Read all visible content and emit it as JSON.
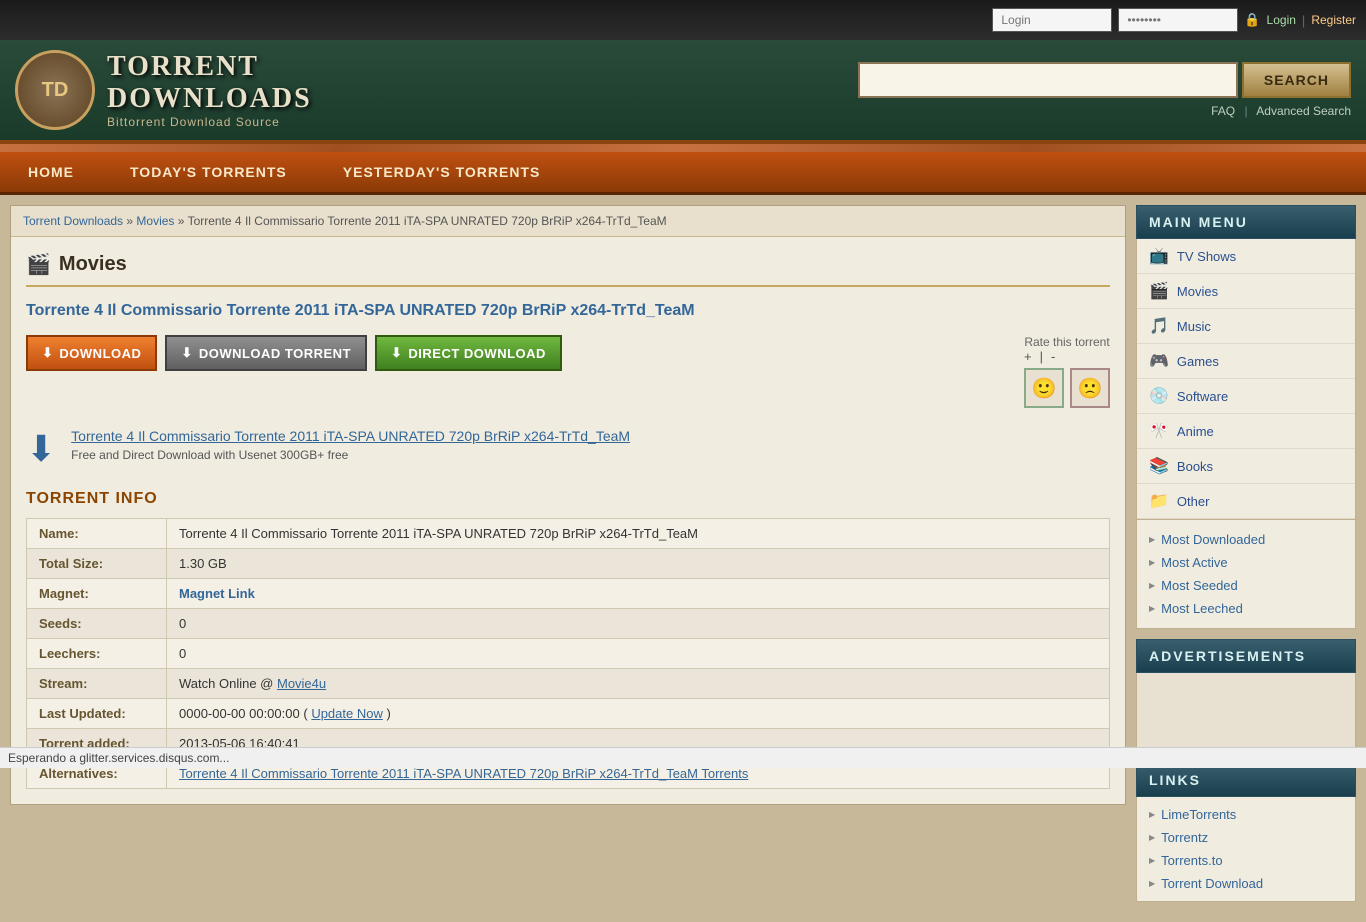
{
  "topbar": {
    "login_placeholder": "Login",
    "password_placeholder": "••••••••",
    "login_label": "Login",
    "register_label": "Register"
  },
  "header": {
    "logo_text": "TD",
    "title_line1": "TORRENT",
    "title_line2": "DOWNLOADS",
    "subtitle": "Bittorrent Download Source",
    "search_placeholder": "",
    "search_btn": "SEARCH",
    "faq": "FAQ",
    "advanced_search": "Advanced Search"
  },
  "nav": {
    "home": "HOME",
    "todays": "TODAY'S TORRENTS",
    "yesterdays": "YESTERDAY'S TORRENTS"
  },
  "breadcrumb": {
    "part1": "Torrent Downloads",
    "sep1": " » ",
    "part2": "Movies",
    "sep2": " » ",
    "part3": "Torrente 4 Il Commissario Torrente 2011 iTA-SPA UNRATED 720p BrRiP x264-TrTd_TeaM"
  },
  "page": {
    "section": "Movies",
    "torrent_title": "Torrente 4 Il Commissario Torrente 2011 iTA-SPA UNRATED 720p BrRiP x264-TrTd_TeaM",
    "btn_download": "DOWNLOAD",
    "btn_download_torrent": "DOWNLOAD TORRENT",
    "btn_direct_download": "DIRECT DOWNLOAD",
    "rate_label": "Rate this torrent",
    "rate_plus": "+",
    "rate_separator": "|",
    "rate_minus": "-",
    "usenet_link": "Torrente 4 Il Commissario Torrente 2011 iTA-SPA UNRATED 720p BrRiP x264-TrTd_TeaM",
    "usenet_text": "Free and Direct Download with Usenet 300GB+ free",
    "section_title": "TORRENT INFO",
    "info": {
      "name_label": "Name:",
      "name_value": "Torrente 4 Il Commissario Torrente 2011 iTA-SPA UNRATED 720p BrRiP x264-TrTd_TeaM",
      "size_label": "Total Size:",
      "size_value": "1.30 GB",
      "magnet_label": "Magnet:",
      "magnet_value": "Magnet Link",
      "seeds_label": "Seeds:",
      "seeds_value": "0",
      "leechers_label": "Leechers:",
      "leechers_value": "0",
      "stream_label": "Stream:",
      "stream_text": "Watch Online @ ",
      "stream_link": "Movie4u",
      "updated_label": "Last Updated:",
      "updated_value": "0000-00-00 00:00:00",
      "update_now": "Update Now",
      "added_label": "Torrent added:",
      "added_value": "2013-05-06 16:40:41",
      "alt_label": "Alternatives:",
      "alt_value": "Torrente 4 Il Commissario Torrente 2011 iTA-SPA UNRATED 720p BrRiP x264-TrTd_TeaM Torrents"
    }
  },
  "sidebar": {
    "main_menu_title": "MAIN MENU",
    "items": [
      {
        "icon": "📺",
        "label": "TV Shows"
      },
      {
        "icon": "🎬",
        "label": "Movies"
      },
      {
        "icon": "🎵",
        "label": "Music"
      },
      {
        "icon": "🎮",
        "label": "Games"
      },
      {
        "icon": "💿",
        "label": "Software"
      },
      {
        "icon": "🎌",
        "label": "Anime"
      },
      {
        "icon": "📚",
        "label": "Books"
      },
      {
        "icon": "📁",
        "label": "Other"
      }
    ],
    "sub_items": [
      "Most Downloaded",
      "Most Active",
      "Most Seeded",
      "Most Leeched"
    ],
    "ads_title": "ADVERTISEMENTS",
    "links_title": "LINKS",
    "links": [
      "LimeTorrents",
      "Torrentz",
      "Torrents.to",
      "Torrent Download"
    ]
  },
  "statusbar": {
    "text": "Esperando a glitter.services.disqus.com..."
  }
}
